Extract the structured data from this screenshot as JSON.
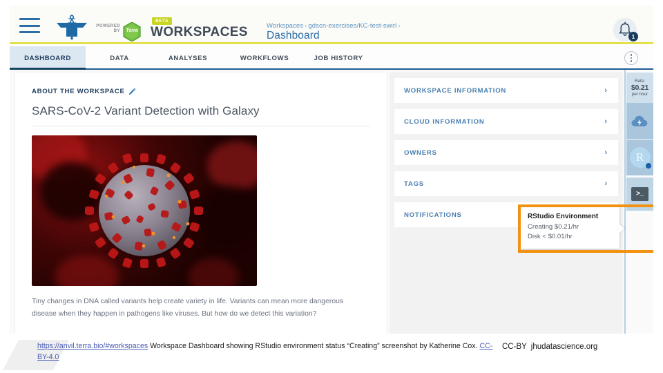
{
  "header": {
    "hamburger_icon": "hamburger-menu-icon",
    "logo_alt": "AnVIL anvil and DNA helix logo",
    "powered_by_line1": "POWERED",
    "powered_by_line2": "BY",
    "terra_label": "Terra",
    "beta_badge": "BETA",
    "product_word": "WORKSPACES",
    "breadcrumb": {
      "root": "Workspaces",
      "separator": "›",
      "workspace": "gdscn-exercises/KC-test-swirl"
    },
    "page_title": "Dashboard",
    "bell_icon": "notification-bell-icon",
    "bell_count": "1"
  },
  "tabs": [
    {
      "label": "DASHBOARD",
      "active": true
    },
    {
      "label": "DATA",
      "active": false
    },
    {
      "label": "ANALYSES",
      "active": false
    },
    {
      "label": "WORKFLOWS",
      "active": false
    },
    {
      "label": "JOB HISTORY",
      "active": false
    }
  ],
  "tab_menu_icon": "kebab-menu-icon",
  "about": {
    "section_label": "ABOUT THE WORKSPACE",
    "edit_icon": "pencil-edit-icon",
    "workspace_title": "SARS-CoV-2 Variant Detection with Galaxy",
    "image_alt": "SARS-CoV-2 virus particle illustration",
    "body_text": "Tiny changes in DNA called variants help create variety in life. Variants can mean more dangerous disease when they happen in pathogens like viruses. But how do we detect this variation?"
  },
  "accordion": [
    {
      "label": "WORKSPACE INFORMATION",
      "chevron": "›",
      "show_chevron": true
    },
    {
      "label": "CLOUD INFORMATION",
      "chevron": "›",
      "show_chevron": true
    },
    {
      "label": "OWNERS",
      "chevron": "›",
      "show_chevron": true
    },
    {
      "label": "TAGS",
      "chevron": "›",
      "show_chevron": true
    },
    {
      "label": "NOTIFICATIONS",
      "chevron": "›",
      "show_chevron": true
    }
  ],
  "env_sidebar": {
    "rate_label": "Rate:",
    "rate_value": "$0.21",
    "rate_unit": "per hour",
    "cloud_icon": "cloud-environment-icon",
    "rstudio_icon_letter": "R",
    "rstudio_icon": "rstudio-environment-icon",
    "rstudio_status_dot": "status-dot-running",
    "terminal_icon": "terminal-icon",
    "terminal_glyph": ">_"
  },
  "tooltip": {
    "title": "RStudio Environment",
    "line_status": "Creating $0.21/hr",
    "line_disk": "Disk < $0.01/hr",
    "highlight_color": "#f39112"
  },
  "caption": {
    "link_url_text": "https://anvil.terra.bio/#workspaces",
    "description": " Workspace Dashboard showing RStudio environment status “Creating” screenshot by Katherine Cox. ",
    "license_link_text": "CC-BY-4.0",
    "credit_license": "CC-BY",
    "credit_site": "jhudatascience.org"
  }
}
